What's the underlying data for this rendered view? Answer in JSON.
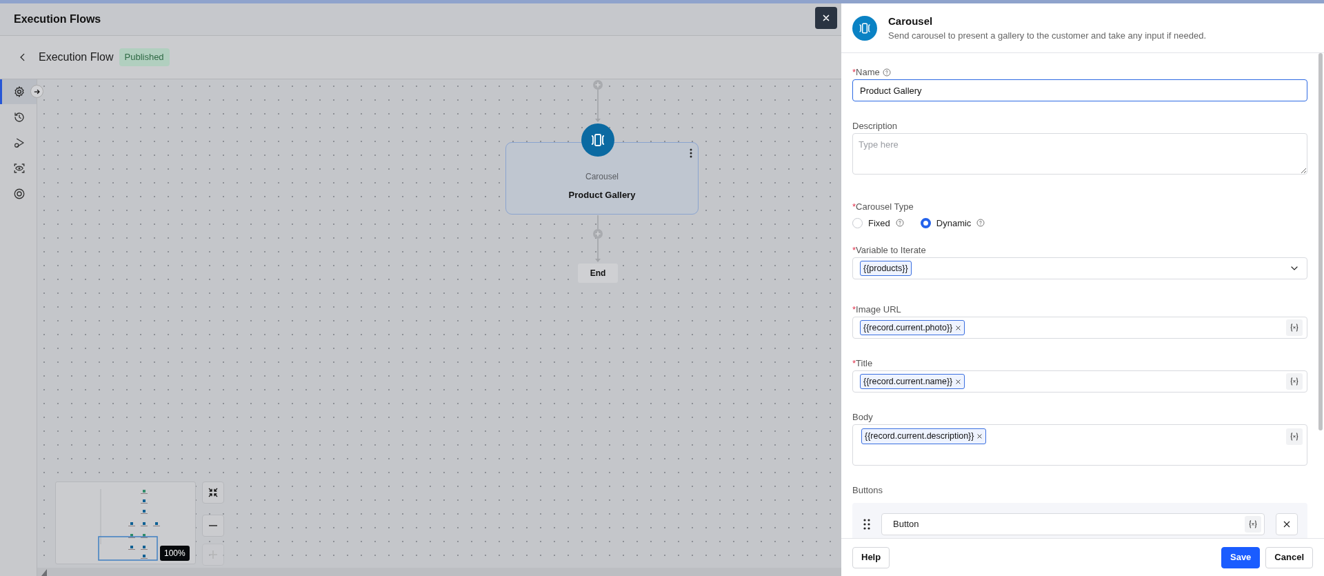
{
  "app": {
    "title": "Execution Flows"
  },
  "flow": {
    "title": "Execution Flow",
    "status": "Published"
  },
  "rail": [
    {
      "kind": "settings",
      "selected": true
    },
    {
      "kind": "history",
      "selected": false
    },
    {
      "kind": "run",
      "selected": false
    },
    {
      "kind": "preview",
      "selected": false
    },
    {
      "kind": "mention",
      "selected": false
    }
  ],
  "canvas": {
    "node": {
      "type": "Carousel",
      "name": "Product Gallery"
    },
    "end": "End"
  },
  "minimap": {
    "zoom": "100%"
  },
  "panel": {
    "title": "Carousel",
    "description": "Send carousel to present a gallery to the customer and take any input if needed.",
    "fields": [
      {
        "kind": "text",
        "required_mark": "*",
        "label": "Name",
        "help": true,
        "value": "Product Gallery",
        "focused": true
      },
      {
        "kind": "textarea",
        "label": "Description",
        "placeholder": "Type here"
      },
      {
        "kind": "radio",
        "required_mark": "*",
        "label": "Carousel Type",
        "options": [
          {
            "label": "Fixed",
            "selected": false,
            "help": true
          },
          {
            "label": "Dynamic",
            "selected": true,
            "help": true
          }
        ]
      },
      {
        "kind": "select",
        "required_mark": "*",
        "label": "Variable to Iterate",
        "tags": [
          {
            "text": "{{products}}",
            "removable": false
          }
        ]
      },
      {
        "kind": "tags",
        "required_mark": "*",
        "label": "Image URL",
        "tags": [
          {
            "text": "{{record.current.photo}}",
            "removable": true
          }
        ]
      },
      {
        "kind": "tags",
        "required_mark": "*",
        "label": "Title",
        "tags": [
          {
            "text": "{{record.current.name}}",
            "removable": true
          }
        ]
      },
      {
        "kind": "tags-area",
        "label": "Body",
        "tags": [
          {
            "text": "{{record.current.description}}",
            "removable": true
          }
        ]
      }
    ],
    "buttons_section": {
      "label": "Buttons",
      "items": [
        {
          "value": "Button"
        }
      ]
    },
    "footer": {
      "help": "Help",
      "save": "Save",
      "cancel": "Cancel"
    }
  }
}
